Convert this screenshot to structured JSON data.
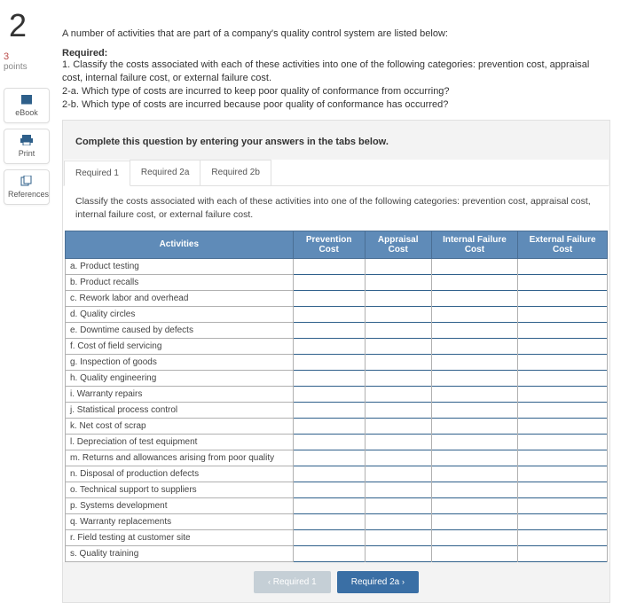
{
  "left": {
    "question_number": "2",
    "points_number": "3",
    "points_label": "points",
    "tools": {
      "ebook": "eBook",
      "print": "Print",
      "references": "References"
    }
  },
  "intro": "A number of activities that are part of a company's quality control system are listed below:",
  "required_heading": "Required:",
  "required_text": "1. Classify the costs associated with each of these activities into one of the following categories: prevention cost, appraisal cost, internal failure cost, or external failure cost.\n2-a. Which type of costs are incurred to keep poor quality of conformance from occurring?\n2-b. Which type of costs are incurred because poor quality of conformance has occurred?",
  "card_instruction": "Complete this question by entering your answers in the tabs below.",
  "tabs": [
    {
      "label": "Required 1"
    },
    {
      "label": "Required 2a"
    },
    {
      "label": "Required 2b"
    }
  ],
  "tab_description": "Classify the costs associated with each of these activities into one of the following categories: prevention cost, appraisal cost, internal failure cost, or external failure cost.",
  "columns": {
    "activities": "Activities",
    "prevention": "Prevention Cost",
    "appraisal": "Appraisal Cost",
    "internal": "Internal Failure Cost",
    "external": "External Failure Cost"
  },
  "rows": [
    "a. Product testing",
    "b. Product recalls",
    "c. Rework labor and overhead",
    "d. Quality circles",
    "e. Downtime caused by defects",
    "f. Cost of field servicing",
    "g. Inspection of goods",
    "h. Quality engineering",
    "i. Warranty repairs",
    "j. Statistical process control",
    "k. Net cost of scrap",
    "l. Depreciation of test equipment",
    "m. Returns and allowances arising from poor quality",
    "n. Disposal of production defects",
    "o. Technical support to suppliers",
    "p. Systems development",
    "q. Warranty replacements",
    "r. Field testing at customer site",
    "s. Quality training"
  ],
  "nav": {
    "prev": "Required 1",
    "next": "Required 2a"
  }
}
